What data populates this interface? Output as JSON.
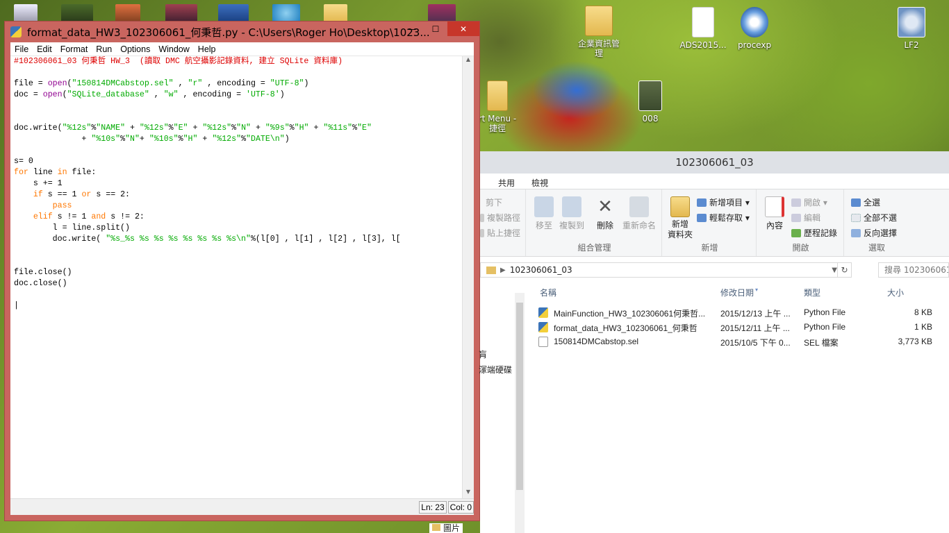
{
  "desktop": {
    "icons": [
      {
        "label": "企業資訊管\n理",
        "icon": "folder-icon"
      },
      {
        "label": "ADS2015...",
        "icon": "file-icon"
      },
      {
        "label": "procexp",
        "icon": "procexp-icon"
      },
      {
        "label": "LF2",
        "icon": "gear-icon"
      },
      {
        "label": "008",
        "icon": "photo-icon"
      },
      {
        "label": "rt Menu -\n捷徑",
        "icon": "shortcut-folder-icon"
      }
    ]
  },
  "idle": {
    "title": "format_data_HW3_102306061_何秉哲.py - C:\\Users\\Roger Ho\\Desktop\\1023...",
    "window_buttons": {
      "minimize": "—",
      "maximize": "☐",
      "close": "✕"
    },
    "menu": [
      "File",
      "Edit",
      "Format",
      "Run",
      "Options",
      "Window",
      "Help"
    ],
    "status": {
      "line": "Ln: 23",
      "col": "Col: 0"
    }
  },
  "explorer": {
    "title": "102306061_03",
    "tabs": [
      "共用",
      "檢視"
    ],
    "clipboard": {
      "cut": "剪下",
      "copy_path": "複製路徑",
      "paste_shortcut": "貼上捷徑"
    },
    "organize": {
      "move_to": "移至",
      "copy_to": "複製到",
      "delete": "刪除",
      "rename": "重新命名",
      "group_label": "組合管理"
    },
    "new": {
      "new_folder": "新增\n資料夾",
      "new_item": "新增項目 ▾",
      "easy_access": "輕鬆存取 ▾",
      "group_label": "新增"
    },
    "open": {
      "properties": "內容",
      "open": "開啟 ▾",
      "edit": "編輯",
      "history": "歷程記錄",
      "group_label": "開啟"
    },
    "select": {
      "select_all": "全選",
      "select_none": "全部不選",
      "invert": "反向選擇",
      "group_label": "選取"
    },
    "address": {
      "path": "102306061_03"
    },
    "search": {
      "placeholder": "搜尋 102306061_..."
    },
    "nav": {
      "item1": "肓",
      "item2": "溕端硬碟",
      "item3": "圖片"
    },
    "columns": {
      "name": "名稱",
      "modified": "修改日期",
      "type": "類型",
      "size": "大小"
    },
    "files": [
      {
        "name": "MainFunction_HW3_102306061何秉哲...",
        "modified": "2015/12/13 上午 ...",
        "type": "Python File",
        "size": "8 KB",
        "icon": "python-file-icon"
      },
      {
        "name": "format_data_HW3_102306061_何秉哲",
        "modified": "2015/12/11 上午 ...",
        "type": "Python File",
        "size": "1 KB",
        "icon": "python-file-icon"
      },
      {
        "name": "150814DMCabstop.sel",
        "modified": "2015/10/5 下午 0...",
        "type": "SEL 檔案",
        "size": "3,773 KB",
        "icon": "sel-file-icon"
      }
    ]
  },
  "code_lines": [
    [
      {
        "c": "cm",
        "t": "#102306061_03 何秉哲 HW_3  (讀取 DMC 航空攝影記錄資料, 建立 SQLite 資料庫)"
      }
    ],
    [],
    [
      {
        "c": "",
        "t": "file = "
      },
      {
        "c": "bi",
        "t": "open"
      },
      {
        "c": "",
        "t": "("
      },
      {
        "c": "st",
        "t": "\"150814DMCabstop.sel\""
      },
      {
        "c": "",
        "t": " , "
      },
      {
        "c": "st",
        "t": "\"r\""
      },
      {
        "c": "",
        "t": " , encoding = "
      },
      {
        "c": "st",
        "t": "\"UTF-8\""
      },
      {
        "c": "",
        "t": ")"
      }
    ],
    [
      {
        "c": "",
        "t": "doc = "
      },
      {
        "c": "bi",
        "t": "open"
      },
      {
        "c": "",
        "t": "("
      },
      {
        "c": "st",
        "t": "\"SQLite_database\""
      },
      {
        "c": "",
        "t": " , "
      },
      {
        "c": "st",
        "t": "\"w\""
      },
      {
        "c": "",
        "t": " , encoding = "
      },
      {
        "c": "st",
        "t": "'UTF-8'"
      },
      {
        "c": "",
        "t": ")"
      }
    ],
    [],
    [],
    [
      {
        "c": "",
        "t": "doc.write("
      },
      {
        "c": "st",
        "t": "\"%12s\""
      },
      {
        "c": "",
        "t": "%"
      },
      {
        "c": "st",
        "t": "\"NAME\""
      },
      {
        "c": "",
        "t": " + "
      },
      {
        "c": "st",
        "t": "\"%12s\""
      },
      {
        "c": "",
        "t": "%"
      },
      {
        "c": "st",
        "t": "\"E\""
      },
      {
        "c": "",
        "t": " + "
      },
      {
        "c": "st",
        "t": "\"%12s\""
      },
      {
        "c": "",
        "t": "%"
      },
      {
        "c": "st",
        "t": "\"N\""
      },
      {
        "c": "",
        "t": " + "
      },
      {
        "c": "st",
        "t": "\"%9s\""
      },
      {
        "c": "",
        "t": "%"
      },
      {
        "c": "st",
        "t": "\"H\""
      },
      {
        "c": "",
        "t": " + "
      },
      {
        "c": "st",
        "t": "\"%11s\""
      },
      {
        "c": "",
        "t": "%"
      },
      {
        "c": "st",
        "t": "\"E\""
      }
    ],
    [
      {
        "c": "",
        "t": "              + "
      },
      {
        "c": "st",
        "t": "\"%10s\""
      },
      {
        "c": "",
        "t": "%"
      },
      {
        "c": "st",
        "t": "\"N\""
      },
      {
        "c": "",
        "t": "+ "
      },
      {
        "c": "st",
        "t": "\"%10s\""
      },
      {
        "c": "",
        "t": "%"
      },
      {
        "c": "st",
        "t": "\"H\""
      },
      {
        "c": "",
        "t": " + "
      },
      {
        "c": "st",
        "t": "\"%12s\""
      },
      {
        "c": "",
        "t": "%"
      },
      {
        "c": "st",
        "t": "\"DATE\\n\""
      },
      {
        "c": "",
        "t": ")"
      }
    ],
    [],
    [
      {
        "c": "",
        "t": "s= 0"
      }
    ],
    [
      {
        "c": "kw",
        "t": "for"
      },
      {
        "c": "",
        "t": " line "
      },
      {
        "c": "kw",
        "t": "in"
      },
      {
        "c": "",
        "t": " file:"
      }
    ],
    [
      {
        "c": "",
        "t": "    s += 1"
      }
    ],
    [
      {
        "c": "",
        "t": "    "
      },
      {
        "c": "kw",
        "t": "if"
      },
      {
        "c": "",
        "t": " s == 1 "
      },
      {
        "c": "kw",
        "t": "or"
      },
      {
        "c": "",
        "t": " s == 2:"
      }
    ],
    [
      {
        "c": "",
        "t": "        "
      },
      {
        "c": "kw",
        "t": "pass"
      }
    ],
    [
      {
        "c": "",
        "t": "    "
      },
      {
        "c": "kw",
        "t": "elif"
      },
      {
        "c": "",
        "t": " s != 1 "
      },
      {
        "c": "kw",
        "t": "and"
      },
      {
        "c": "",
        "t": " s != 2:"
      }
    ],
    [
      {
        "c": "",
        "t": "        l = line.split()"
      }
    ],
    [
      {
        "c": "",
        "t": "        doc.write( "
      },
      {
        "c": "st",
        "t": "\"%s_%s %s %s %s %s %s %s %s\\n\""
      },
      {
        "c": "",
        "t": "%(l[0] , l[1] , l[2] , l[3], l["
      }
    ],
    [],
    [],
    [
      {
        "c": "",
        "t": "file.close()"
      }
    ],
    [
      {
        "c": "",
        "t": "doc.close()"
      }
    ],
    [],
    [
      {
        "c": "",
        "t": "|"
      }
    ]
  ],
  "colors": {
    "comment": "#dd0000",
    "keyword": "#ff7700",
    "string": "#00aa00",
    "builtin": "#900090",
    "idle_frame": "#c9655f",
    "close_button": "#c7362a"
  }
}
